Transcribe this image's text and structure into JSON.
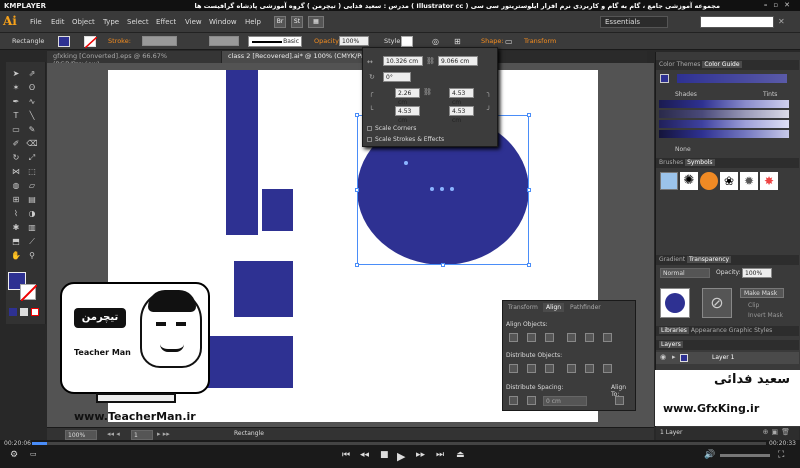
{
  "player": {
    "brand": "KMPLAYER",
    "time_elapsed": "00:20:06",
    "time_total": "00:20:33",
    "progress_fraction": 0.02
  },
  "menubar": {
    "logo": "Ai",
    "items": [
      "File",
      "Edit",
      "Object",
      "Type",
      "Select",
      "Effect",
      "View",
      "Window",
      "Help"
    ],
    "bridge": "Br",
    "stock": "St",
    "window_title": "مجموعه آموزشی جامع ، گام به گام و کاربردی نرم افزار ایلوستریتور سی سی ( Illustrator cc )   مدرس : سعید فدایی ( تیچرمن ) گروه آموزشی پادشاه گرافیست ها",
    "workspace": "Essentials",
    "search_placeholder": ""
  },
  "control_bar": {
    "selection": "Rectangle",
    "stroke_label": "Stroke:",
    "brush_label": "Basic",
    "opacity_label": "Opacity:",
    "opacity_value": "100%",
    "style_label": "Style:",
    "shape_label": "Shape:",
    "transform_label": "Transform"
  },
  "tabs": [
    {
      "label": "gfxking [Converted].eps @ 66.67% (RGB/Preview)",
      "active": false
    },
    {
      "label": "class 2 [Recovered].ai* @ 100% (CMYK/Preview)",
      "active": true
    }
  ],
  "transform_panel": {
    "width": "10.326 cm",
    "height": "9.066 cm",
    "angle": "0°",
    "corner_tl": "4.53 cm",
    "corner_tr": "4.53 cm",
    "corner_bl": "4.53 cm",
    "corner_br": "4.53 cm",
    "scale_corners": "Scale Corners",
    "scale_strokes": "Scale Strokes & Effects",
    "radius_left": "2.26 cm"
  },
  "align_panel": {
    "tabs": [
      "Transform",
      "Align",
      "Pathfinder"
    ],
    "align_objects": "Align Objects:",
    "distribute_objects": "Distribute Objects:",
    "distribute_spacing": "Distribute Spacing:",
    "align_to": "Align To:",
    "spacing_value": "0 cm"
  },
  "right_panels": {
    "color_tabs": [
      "Color Themes",
      "Color Guide"
    ],
    "shades": "Shades",
    "tints": "Tints",
    "none_label": "None",
    "brush_tabs": [
      "Brushes",
      "Symbols"
    ],
    "gradient_tabs": [
      "Gradient",
      "Transparency"
    ],
    "blend_mode": "Normal",
    "opacity_label": "Opacity:",
    "opacity_value": "100%",
    "make_mask": "Make Mask",
    "clip": "Clip",
    "invert_mask": "Invert Mask",
    "library_tabs": [
      "Libraries",
      "Appearance",
      "Graphic Styles"
    ],
    "layers_tab": "Layers",
    "layer_name": "Layer 1",
    "layers_count": "1 Layer"
  },
  "bottom_bar": {
    "zoom": "100%",
    "artboard": "1",
    "tool": "Rectangle"
  },
  "watermarks": {
    "teacher_url": "www.TeacherMan.ir",
    "teacher_fa": "تیچرمن",
    "teacher_en": "Teacher Man",
    "gfx_fa": "سعید فدائی",
    "gfx_url": "www.GfxKing.ir"
  },
  "colors": {
    "accent": "#2e3192",
    "ai_orange": "#f7a21b",
    "selection": "#4a8df8"
  }
}
